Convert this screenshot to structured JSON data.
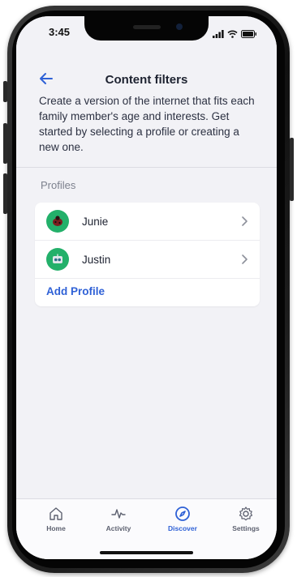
{
  "status": {
    "time": "3:45"
  },
  "header": {
    "title": "Content filters",
    "description": "Create a version of the internet that fits each family member's age and interests. Get started by selecting a profile or creating a new one."
  },
  "profiles": {
    "section_label": "Profiles",
    "items": [
      {
        "name": "Junie",
        "avatar_icon": "ladybug-avatar-icon"
      },
      {
        "name": "Justin",
        "avatar_icon": "robot-avatar-icon"
      }
    ],
    "add_label": "Add Profile"
  },
  "tabbar": {
    "items": [
      {
        "label": "Home",
        "icon": "home-icon"
      },
      {
        "label": "Activity",
        "icon": "activity-icon"
      },
      {
        "label": "Discover",
        "icon": "compass-icon"
      },
      {
        "label": "Settings",
        "icon": "gear-icon"
      }
    ],
    "active": "Discover"
  },
  "colors": {
    "accent": "#2f61d6",
    "avatar_bg": "#23b06a",
    "screen_bg": "#f2f2f6"
  }
}
